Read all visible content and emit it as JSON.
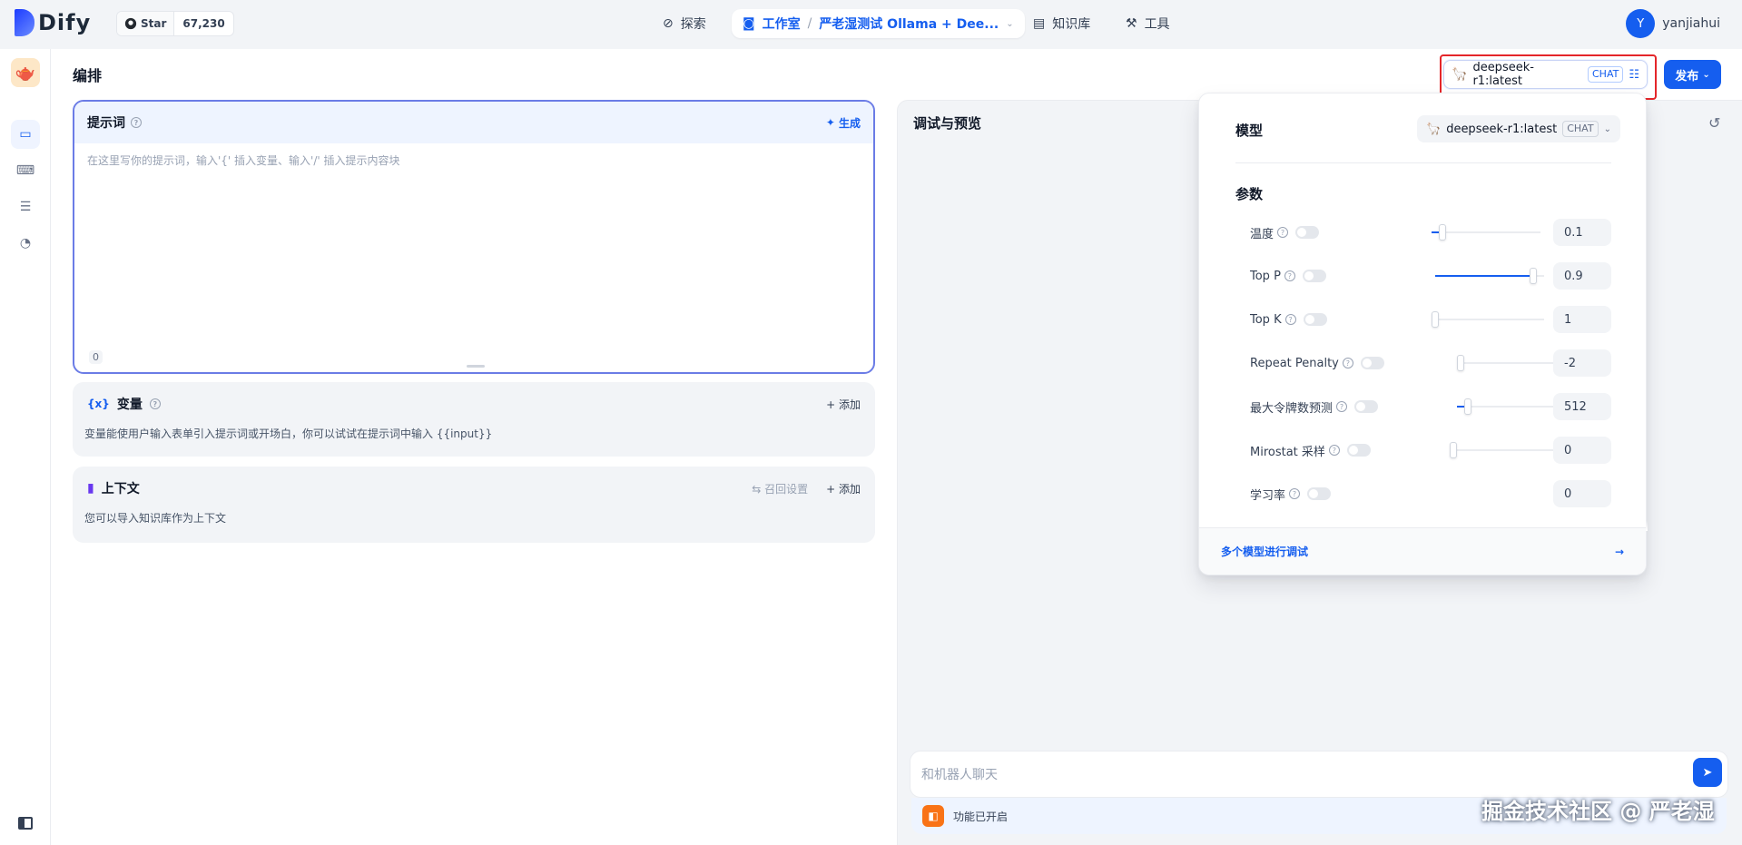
{
  "header": {
    "logo": "Dify",
    "github": {
      "star_label": "Star",
      "count": "67,230"
    },
    "nav": [
      {
        "label": "探索",
        "icon": "compass-icon"
      },
      {
        "label": "工作室",
        "icon": "robot-icon",
        "sub": "严老湿测试 Ollama + Dee..."
      },
      {
        "label": "知识库",
        "icon": "book-icon"
      },
      {
        "label": "工具",
        "icon": "hammer-icon"
      }
    ],
    "user": {
      "initial": "Y",
      "name": "yanjiahui"
    }
  },
  "editor": {
    "title": "编排",
    "prompt": {
      "title": "提示词",
      "generate_label": "生成",
      "placeholder": "在这里写你的提示词，输入'{' 插入变量、输入'/' 插入提示内容块",
      "count": "0"
    },
    "variables": {
      "title": "变量",
      "add_label": "添加",
      "description": "变量能使用户输入表单引入提示词或开场白，你可以试试在提示词中输入 {{input}}"
    },
    "context": {
      "title": "上下文",
      "recall_label": "召回设置",
      "add_label": "添加",
      "description": "您可以导入知识库作为上下文"
    }
  },
  "toolbar": {
    "model_name": "deepseek-r1:latest",
    "model_mode": "CHAT",
    "publish_label": "发布"
  },
  "debug": {
    "title": "调试与预览",
    "chat_placeholder": "和机器人聊天",
    "feature_label": "功能已开启",
    "watermark": "掘金技术社区 @ 严老湿"
  },
  "model_panel": {
    "model_label": "模型",
    "model_name": "deepseek-r1:latest",
    "model_mode": "CHAT",
    "params_label": "参数",
    "params": [
      {
        "name": "温度",
        "value": "0.1",
        "level": 0.1
      },
      {
        "name": "Top P",
        "value": "0.9",
        "level": 0.9
      },
      {
        "name": "Top K",
        "value": "1",
        "level": 0.0
      },
      {
        "name": "Repeat Penalty",
        "value": "-2",
        "level": 0.0
      },
      {
        "name": "最大令牌数预测",
        "value": "512",
        "level": 0.1
      },
      {
        "name": "Mirostat 采样",
        "value": "0",
        "level": 0.0
      },
      {
        "name": "学习率",
        "value": "0",
        "level": null
      }
    ],
    "footer_label": "多个模型进行调试"
  },
  "colors": {
    "accent": "#155eef",
    "highlight": "#e4262a"
  }
}
